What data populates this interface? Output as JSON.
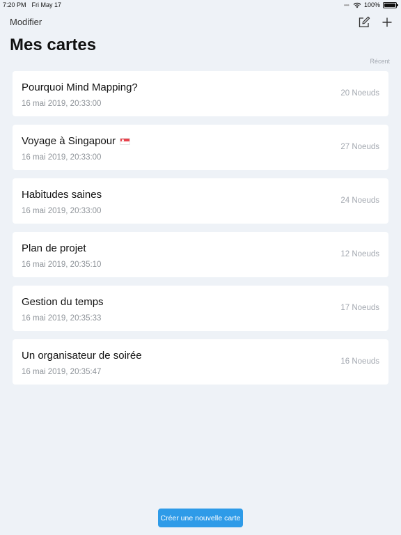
{
  "status_bar": {
    "time": "7:20 PM",
    "date": "Fri May 17",
    "battery": "100%",
    "battery_level": 1.0
  },
  "nav": {
    "edit_label": "Modifier",
    "compose_icon": "compose-icon",
    "add_icon": "plus-icon"
  },
  "page": {
    "title": "Mes cartes",
    "sort_label": "Récent"
  },
  "maps": [
    {
      "title": "Pourquoi Mind Mapping?",
      "date": "16 mai 2019, 20:33:00",
      "count": "20 Noeuds",
      "flag": false
    },
    {
      "title": "Voyage à Singapour",
      "date": "16 mai 2019, 20:33:00",
      "count": "27 Noeuds",
      "flag": true
    },
    {
      "title": "Habitudes saines",
      "date": "16 mai 2019, 20:33:00",
      "count": "24 Noeuds",
      "flag": false
    },
    {
      "title": "Plan de projet",
      "date": "16 mai 2019, 20:35:10",
      "count": "12 Noeuds",
      "flag": false
    },
    {
      "title": "Gestion du temps",
      "date": "16 mai 2019, 20:35:33",
      "count": "17 Noeuds",
      "flag": false
    },
    {
      "title": "Un organisateur de soirée",
      "date": "16 mai 2019, 20:35:47",
      "count": "16 Noeuds",
      "flag": false
    }
  ],
  "footer": {
    "create_label": "Créer une nouvelle carte"
  },
  "colors": {
    "background": "#eef2f7",
    "accent": "#2e9be8",
    "card": "#ffffff"
  }
}
